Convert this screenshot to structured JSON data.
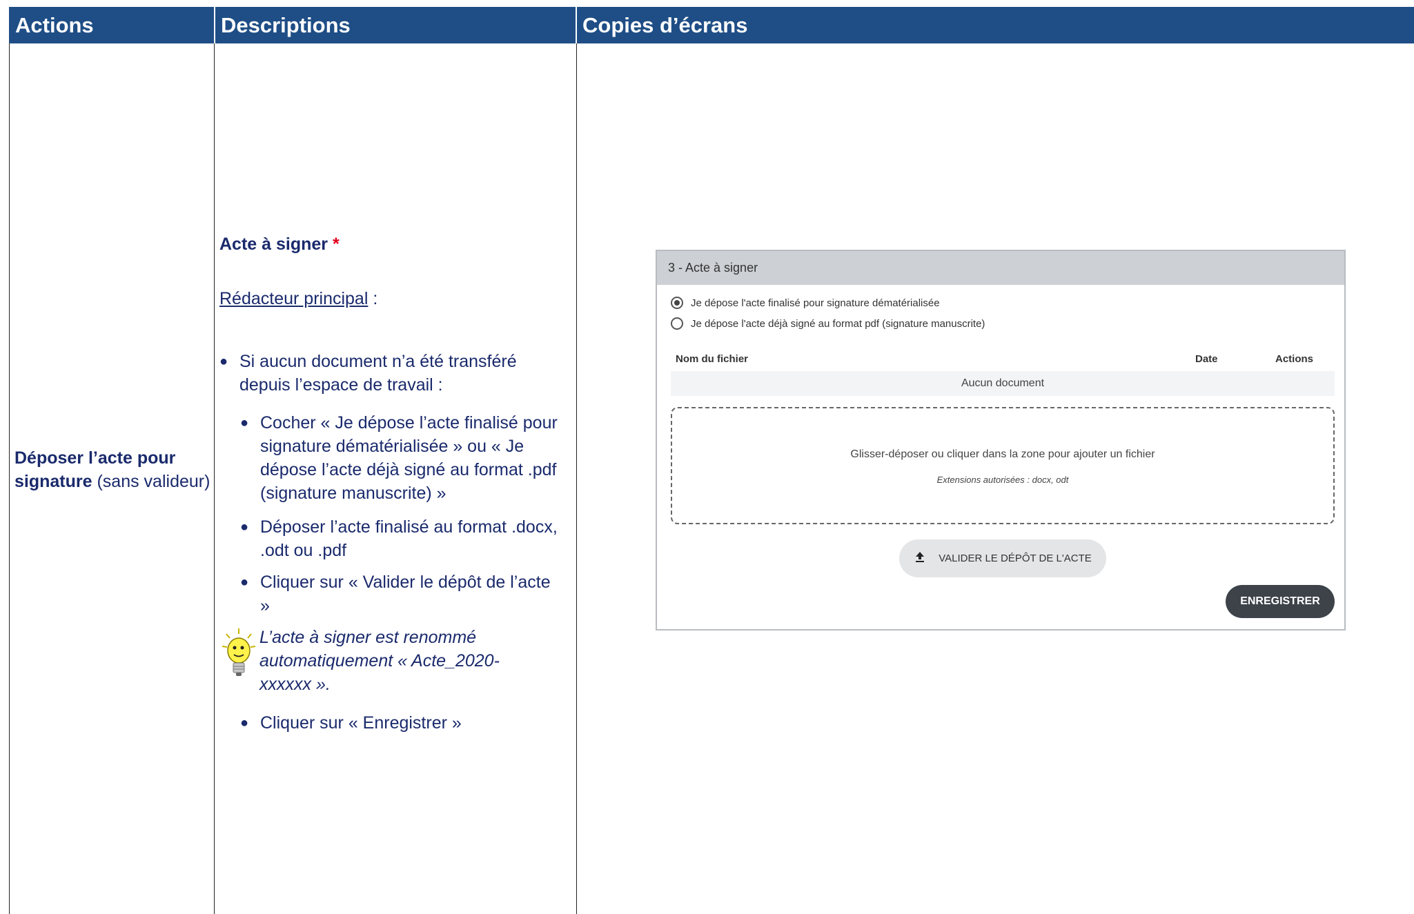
{
  "headers": {
    "actions": "Actions",
    "descriptions": "Descriptions",
    "screenshots": "Copies d’écrans"
  },
  "action": {
    "bold": "Déposer l’acte pour signature",
    "rest": " (sans valideur)"
  },
  "description": {
    "title": "Acte à signer",
    "title_star": "*",
    "role": "Rédacteur principal",
    "role_suffix": " :",
    "bullet1": "Si aucun document n’a été transféré depuis l’espace de travail :",
    "bullet2": "Cocher « Je dépose l’acte finalisé pour signature dématérialisée » ou « Je dépose l’acte déjà signé au format .pdf (signature manuscrite) »",
    "bullet3": "Déposer l’acte finalisé au format .docx, .odt ou .pdf",
    "bullet4": "Cliquer sur « Valider le dépôt de l’acte »",
    "tip": "L’acte à signer est renommé automatiquement « Acte_2020-xxxxxx ».",
    "bullet5": "Cliquer sur « Enregistrer »"
  },
  "screenshot": {
    "panel_title": "3 - Acte à signer",
    "radio1": "Je dépose l'acte finalisé pour signature dématérialisée",
    "radio2": "Je dépose l'acte déjà signé au format pdf (signature manuscrite)",
    "radio_selected": 1,
    "col_name": "Nom du fichier",
    "col_date": "Date",
    "col_actions": "Actions",
    "empty_row": "Aucun document",
    "dropzone_text": "Glisser-déposer ou cliquer dans la zone pour ajouter un fichier",
    "dropzone_ext": "Extensions autorisées : docx, odt",
    "validate_label": "VALIDER LE DÉPÔT DE L'ACTE",
    "save_label": "ENREGISTRER"
  },
  "colors": {
    "header_bg": "#1f4e86",
    "text_navy": "#1a2a6c",
    "required_star": "#e0001b"
  }
}
